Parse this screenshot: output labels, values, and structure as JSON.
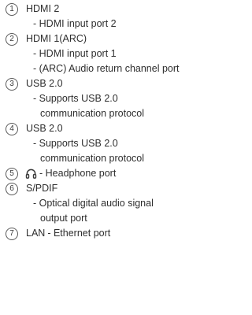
{
  "items": [
    {
      "number": "1",
      "title": "HDMI 2",
      "lines": [
        "- HDMI input port 2"
      ]
    },
    {
      "number": "2",
      "title": "HDMI 1(ARC)",
      "lines": [
        "- HDMI input port 1",
        "- (ARC) Audio return channel port"
      ]
    },
    {
      "number": "3",
      "title": "USB 2.0",
      "lines": [
        "- Supports USB 2.0",
        "communication protocol"
      ]
    },
    {
      "number": "4",
      "title": "USB 2.0",
      "lines": [
        "- Supports USB 2.0",
        "communication protocol"
      ]
    },
    {
      "number": "5",
      "icon": "headphone-icon",
      "suffix": "- Headphone port"
    },
    {
      "number": "6",
      "title": "S/PDIF",
      "lines": [
        "- Optical digital audio signal",
        "output port"
      ]
    },
    {
      "number": "7",
      "title": "LAN",
      "suffix": "- Ethernet port"
    }
  ]
}
